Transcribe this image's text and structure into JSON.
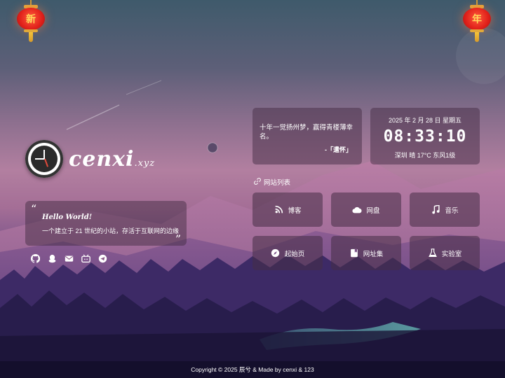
{
  "lanterns": {
    "left_char": "新",
    "right_char": "年"
  },
  "logo": {
    "brand": "cenxi",
    "suffix": ".xyz"
  },
  "quote": {
    "open_mark": "“",
    "close_mark": "”",
    "hello": "Hello World!",
    "desc": "一个建立于 21 世纪的小站，存活于互联网的边缘"
  },
  "socials": [
    {
      "icon": "github-icon"
    },
    {
      "icon": "qq-icon"
    },
    {
      "icon": "mail-icon"
    },
    {
      "icon": "bilibili-icon"
    },
    {
      "icon": "telegram-icon"
    }
  ],
  "hitokoto": {
    "text": "十年一觉扬州梦，赢得青楼薄幸名。",
    "from": "-「遣怀」"
  },
  "time": {
    "date": "2025 年 2 月 28 日 星期五",
    "clock": "08:33:10",
    "weather": "深圳 晴 17°C 东风1级"
  },
  "sites": {
    "title": "网站列表",
    "items": [
      {
        "label": "博客",
        "icon": "blog-icon"
      },
      {
        "label": "网盘",
        "icon": "cloud-icon"
      },
      {
        "label": "音乐",
        "icon": "music-icon"
      },
      {
        "label": "起始页",
        "icon": "compass-icon"
      },
      {
        "label": "网址集",
        "icon": "bookmark-icon"
      },
      {
        "label": "实验室",
        "icon": "flask-icon"
      }
    ]
  },
  "footer": {
    "text": "Copyright © 2025 辰兮 & Made by cenxi & 123"
  }
}
